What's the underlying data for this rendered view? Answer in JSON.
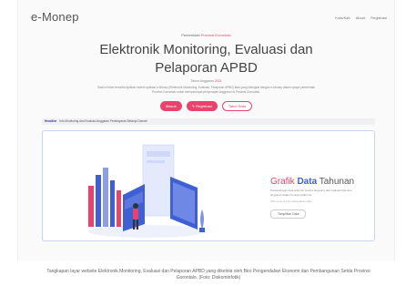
{
  "app": {
    "logo": "e-Monep"
  },
  "nav": {
    "items": [
      "Kota/Kab",
      "About",
      "Registrasi"
    ]
  },
  "hero": {
    "pre_text": "Pemerintah",
    "pre_highlight": "Provinsi Gorontalo",
    "title_line1": "Elektronik Monitoring, Evaluasi dan",
    "title_line2": "Pelaporan APBD",
    "year_label": "Tahun Anggaran",
    "year_value": "2021",
    "description": "Saat ini telah tersedia Aplikasi sistem aplikasi e-Monep (Elektronik Monitoring, Evaluasi, Pelaporan APBD) atau yang disingkat dengan e-Monep dalam upaya pemerintah Provinsi Gorontalo untuk mempercepat penyerapan Anggaran di Provinsi Gorontalo."
  },
  "buttons": {
    "masuk": "Masuk",
    "registrasi": "Registrasi",
    "tabel": "Tabel Data"
  },
  "ticker": {
    "label": "Headline",
    "text": "Info Monitoring dan Evaluasi Anggaran Pembayaran Belanja Daerah"
  },
  "panel": {
    "title_part1": "Grafik",
    "title_part2": "Data",
    "title_part3": "Tahunan",
    "description": "Perbandingan data tahunan secara langsung dari realisasi fisik dan anggaran dalam bentuk grafik line.",
    "note": "Klik menu untuk melanjutkan data",
    "button": "Tampilkan Data"
  },
  "caption": {
    "line1": "Tangkapan layar website Elektronik Monitoring, Evaluasi dan Pelaporan APBD yang dikelola oleh Biro Pengendalian Ekonomi dan Pembangunan Setda Provinsi",
    "line2": "Gorontalo. (Foto: Diskominfotik)"
  },
  "colors": {
    "accent": "#e8436c",
    "blue": "#3f5fd4",
    "panel_border": "#c8d4f4"
  }
}
